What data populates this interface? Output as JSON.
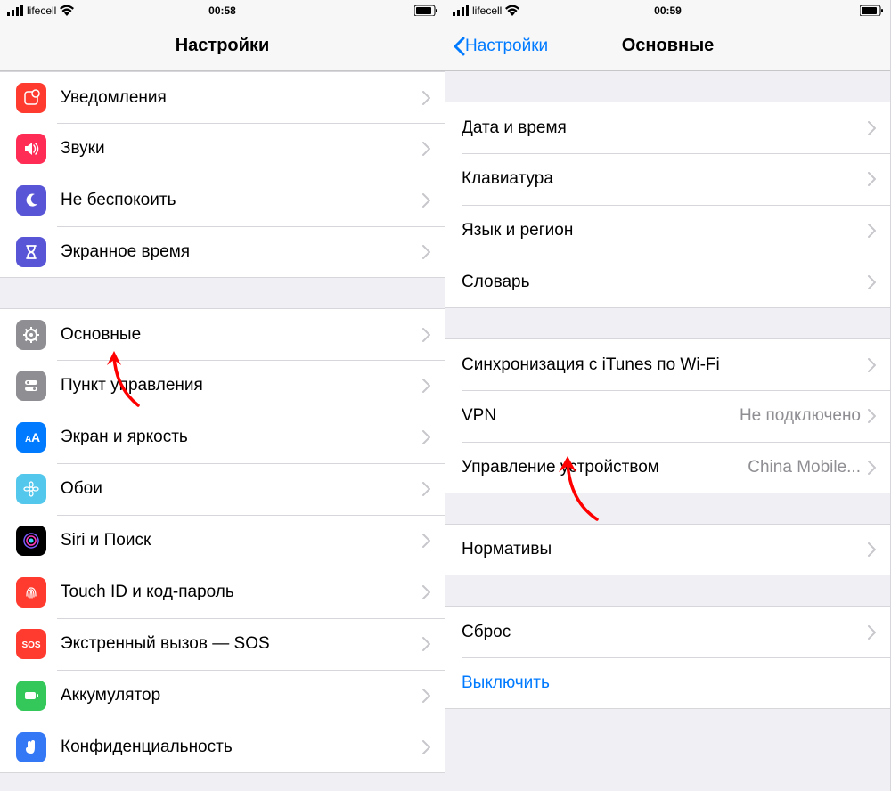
{
  "left": {
    "status": {
      "carrier": "lifecell",
      "time": "00:58"
    },
    "title": "Настройки",
    "group1": [
      {
        "key": "notifications",
        "label": "Уведомления"
      },
      {
        "key": "sounds",
        "label": "Звуки"
      },
      {
        "key": "dnd",
        "label": "Не беспокоить"
      },
      {
        "key": "screentime",
        "label": "Экранное время"
      }
    ],
    "group2": [
      {
        "key": "general",
        "label": "Основные"
      },
      {
        "key": "control",
        "label": "Пункт управления"
      },
      {
        "key": "display",
        "label": "Экран и яркость"
      },
      {
        "key": "wallpaper",
        "label": "Обои"
      },
      {
        "key": "siri",
        "label": "Siri и Поиск"
      },
      {
        "key": "touchid",
        "label": "Touch ID и код-пароль"
      },
      {
        "key": "sos",
        "label": "Экстренный вызов — SOS"
      },
      {
        "key": "battery",
        "label": "Аккумулятор"
      },
      {
        "key": "privacy",
        "label": "Конфиденциальность"
      }
    ]
  },
  "right": {
    "status": {
      "carrier": "lifecell",
      "time": "00:59"
    },
    "back": "Настройки",
    "title": "Основные",
    "group1": [
      {
        "key": "datetime",
        "label": "Дата и время"
      },
      {
        "key": "keyboard",
        "label": "Клавиатура"
      },
      {
        "key": "language",
        "label": "Язык и регион"
      },
      {
        "key": "dict",
        "label": "Словарь"
      }
    ],
    "group2": [
      {
        "key": "itunes",
        "label": "Синхронизация с iTunes по Wi-Fi",
        "value": ""
      },
      {
        "key": "vpn",
        "label": "VPN",
        "value": "Не подключено"
      },
      {
        "key": "mdm",
        "label": "Управление устройством",
        "value": "China Mobile..."
      }
    ],
    "group3": [
      {
        "key": "regulatory",
        "label": "Нормативы"
      }
    ],
    "group4": [
      {
        "key": "reset",
        "label": "Сброс"
      }
    ],
    "shutdown": "Выключить"
  }
}
